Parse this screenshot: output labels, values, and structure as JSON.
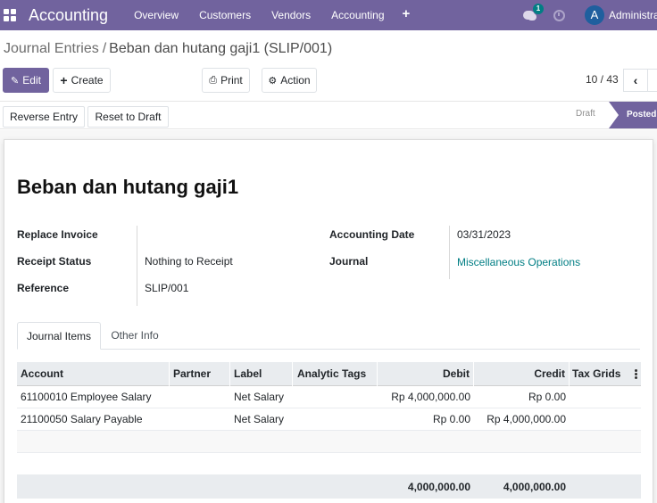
{
  "navbar": {
    "app_name": "Accounting",
    "menu": [
      "Overview",
      "Customers",
      "Vendors",
      "Accounting"
    ],
    "plus_label": "+",
    "chat_badge": "1",
    "avatar_letter": "A",
    "user_name": "Administrator"
  },
  "breadcrumb": {
    "parent": "Journal Entries",
    "separator": "/",
    "current": "Beban dan hutang gaji1 (SLIP/001)"
  },
  "controls": {
    "edit_label": "Edit",
    "create_label": "Create",
    "print_label": "Print",
    "action_label": "Action",
    "pager_value": "10 / 43"
  },
  "statusbar": {
    "reverse_label": "Reverse Entry",
    "reset_label": "Reset to Draft",
    "stages": [
      "Draft",
      "Posted"
    ],
    "active_stage": "Posted"
  },
  "form": {
    "title": "Beban dan hutang gaji1",
    "fields_left": [
      {
        "label": "Replace Invoice",
        "value": ""
      },
      {
        "label": "Receipt Status",
        "value": "Nothing to Receipt"
      },
      {
        "label": "Reference",
        "value": "SLIP/001"
      }
    ],
    "fields_right": [
      {
        "label": "Accounting Date",
        "value": "03/31/2023"
      },
      {
        "label": "Journal",
        "value": "Miscellaneous Operations"
      }
    ]
  },
  "tabs": [
    "Journal Items",
    "Other Info"
  ],
  "active_tab": "Journal Items",
  "table": {
    "columns": [
      "Account",
      "Partner",
      "Label",
      "Analytic Tags",
      "Debit",
      "Credit",
      "Tax Grids"
    ],
    "rows": [
      {
        "account": "61100010 Employee Salary",
        "partner": "",
        "label": "Net Salary",
        "analytic_tags": "",
        "debit": "Rp 4,000,000.00",
        "credit": "Rp 0.00",
        "tax_grids": ""
      },
      {
        "account": "21100050 Salary Payable",
        "partner": "",
        "label": "Net Salary",
        "analytic_tags": "",
        "debit": "Rp 0.00",
        "credit": "Rp 4,000,000.00",
        "tax_grids": ""
      }
    ],
    "totals": {
      "debit": "4,000,000.00",
      "credit": "4,000,000.00"
    }
  },
  "colors": {
    "brand": "#71639e",
    "link": "#017e84",
    "badge": "#017e84"
  }
}
